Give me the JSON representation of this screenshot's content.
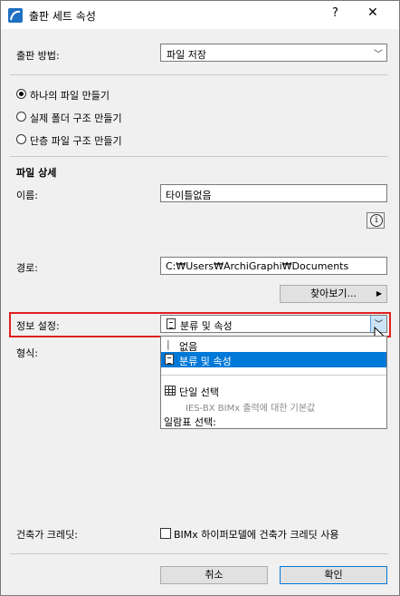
{
  "window": {
    "title": "출판 세트 속성",
    "help": "?",
    "close": "✕"
  },
  "publish": {
    "label": "출판 방법:",
    "value": "파일 저장"
  },
  "radios": [
    {
      "label": "하나의 파일 만들기",
      "checked": true
    },
    {
      "label": "실제 폴더 구조 만들기",
      "checked": false
    },
    {
      "label": "단층 파일 구조 만들기",
      "checked": false
    }
  ],
  "file_details": {
    "heading": "파일 상세",
    "name_label": "이름:",
    "name_value": "타이틀없음",
    "path_label": "경로:",
    "path_value": "C:₩Users₩ArchiGraphi₩Documents",
    "browse_label": "찾아보기...",
    "info_glyph": "i"
  },
  "info_settings": {
    "label": "정보 설정:",
    "value": "분류 및 속성",
    "format_label": "형식:"
  },
  "dropdown": {
    "none": "없음",
    "classification": "분류 및 속성",
    "single_select": "단일 선택",
    "single_desc": "IES-BX BIMx 출력에 대한 기본값",
    "schedule_select": "일람표 선택:"
  },
  "credit": {
    "label": "건축가 크레딧:",
    "checkbox_label": "BIMx 하이퍼모델에 건축가 크레딧 사용"
  },
  "buttons": {
    "cancel": "취소",
    "ok": "확인"
  }
}
